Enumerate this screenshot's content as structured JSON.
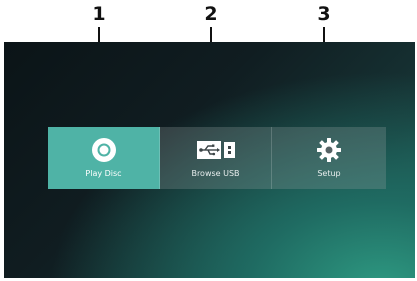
{
  "callouts": [
    {
      "number": "1"
    },
    {
      "number": "2"
    },
    {
      "number": "3"
    }
  ],
  "menu": {
    "items": [
      {
        "label": "Play Disc",
        "icon": "disc-icon",
        "selected": true
      },
      {
        "label": "Browse USB",
        "icon": "usb-icon",
        "selected": false
      },
      {
        "label": "Setup",
        "icon": "gear-icon",
        "selected": false
      }
    ]
  },
  "colors": {
    "selected_tile": "#4fb3a6",
    "background_accent": "#2e9a82"
  }
}
